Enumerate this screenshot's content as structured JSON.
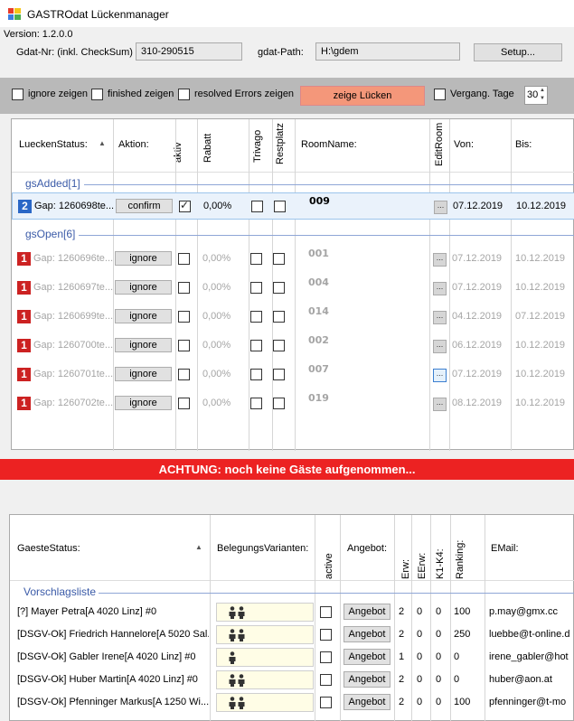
{
  "window": {
    "title": "GASTROdat Lückenmanager"
  },
  "info": {
    "version": "Version: 1.2.0.0",
    "gdat_nr_label": "Gdat-Nr: (inkl. CheckSum)",
    "gdat_nr_value": "310-290515",
    "gdat_path_label": "gdat-Path:",
    "gdat_path_value": "H:\\gdem",
    "setup_label": "Setup..."
  },
  "filters": {
    "ignore_label": "ignore zeigen",
    "finished_label": "finished zeigen",
    "resolved_label": "resolved Errors zeigen",
    "show_button": "zeige Lücken",
    "past_label": "Vergang. Tage",
    "past_days": "30"
  },
  "gaps": {
    "headers": {
      "status": "LueckenStatus:",
      "action": "Aktion:",
      "aktiv": "aktiv",
      "rabatt": "Rabatt",
      "trivago": "Trivago",
      "restplatz": "Restplatz",
      "room": "RoomName:",
      "editroom": "EditRoom",
      "von": "Von:",
      "bis": "Bis:"
    },
    "groups": [
      {
        "label": "gsAdded[1]",
        "rows": [
          {
            "badge": "2",
            "gap": "Gap: 1260698te...",
            "action": "confirm",
            "aktiv": true,
            "rabatt": "0,00%",
            "room": "009",
            "von": "07.12.2019",
            "bis": "10.12.2019"
          }
        ]
      },
      {
        "label": "gsOpen[6]",
        "rows": [
          {
            "badge": "1",
            "gap": "Gap: 1260696te...",
            "action": "ignore",
            "aktiv": false,
            "rabatt": "0,00%",
            "room": "001",
            "von": "07.12.2019",
            "bis": "10.12.2019"
          },
          {
            "badge": "1",
            "gap": "Gap: 1260697te...",
            "action": "ignore",
            "aktiv": false,
            "rabatt": "0,00%",
            "room": "004",
            "von": "07.12.2019",
            "bis": "10.12.2019"
          },
          {
            "badge": "1",
            "gap": "Gap: 1260699te...",
            "action": "ignore",
            "aktiv": false,
            "rabatt": "0,00%",
            "room": "014",
            "von": "04.12.2019",
            "bis": "07.12.2019"
          },
          {
            "badge": "1",
            "gap": "Gap: 1260700te...",
            "action": "ignore",
            "aktiv": false,
            "rabatt": "0,00%",
            "room": "002",
            "von": "06.12.2019",
            "bis": "10.12.2019"
          },
          {
            "badge": "1",
            "gap": "Gap: 1260701te...",
            "action": "ignore",
            "aktiv": false,
            "rabatt": "0,00%",
            "room": "007",
            "von": "07.12.2019",
            "bis": "10.12.2019"
          },
          {
            "badge": "1",
            "gap": "Gap: 1260702te...",
            "action": "ignore",
            "aktiv": false,
            "rabatt": "0,00%",
            "room": "019",
            "von": "08.12.2019",
            "bis": "10.12.2019"
          }
        ]
      }
    ]
  },
  "warning": "ACHTUNG: noch keine Gäste aufgenommen...",
  "guests": {
    "headers": {
      "status": "GaesteStatus:",
      "variants": "BelegungsVarianten:",
      "active": "active",
      "angebot": "Angebot:",
      "erw": "Erw:",
      "eerw": "EErw:",
      "k1k4": "K1-K4:",
      "ranking": "Ranking:",
      "email": "EMail:"
    },
    "group_label": "Vorschlagsliste",
    "rows": [
      {
        "name": "[?] Mayer Petra[A 4020 Linz] #0",
        "persons": 2,
        "angebot": "Angebot",
        "erw": "2",
        "eerw": "0",
        "k": "0",
        "ranking": "100",
        "email": "p.may@gmx.cc"
      },
      {
        "name": "[DSGV-Ok] Friedrich Hannelore[A 5020 Sal...",
        "persons": 2,
        "angebot": "Angebot",
        "erw": "2",
        "eerw": "0",
        "k": "0",
        "ranking": "250",
        "email": "luebbe@t-online.d"
      },
      {
        "name": "[DSGV-Ok] Gabler Irene[A 4020 Linz] #0",
        "persons": 1,
        "angebot": "Angebot",
        "erw": "1",
        "eerw": "0",
        "k": "0",
        "ranking": "0",
        "email": "irene_gabler@hot"
      },
      {
        "name": "[DSGV-Ok] Huber Martin[A 4020 Linz] #0",
        "persons": 2,
        "angebot": "Angebot",
        "erw": "2",
        "eerw": "0",
        "k": "0",
        "ranking": "0",
        "email": "huber@aon.at"
      },
      {
        "name": "[DSGV-Ok] Pfenninger Markus[A 1250 Wi...",
        "persons": 2,
        "angebot": "Angebot",
        "erw": "2",
        "eerw": "0",
        "k": "0",
        "ranking": "100",
        "email": "pfenninger@t-mo"
      }
    ]
  },
  "colors": {
    "warning": "#ec2222",
    "show_button": "#f4977a",
    "group_label": "#3b5ba8"
  }
}
